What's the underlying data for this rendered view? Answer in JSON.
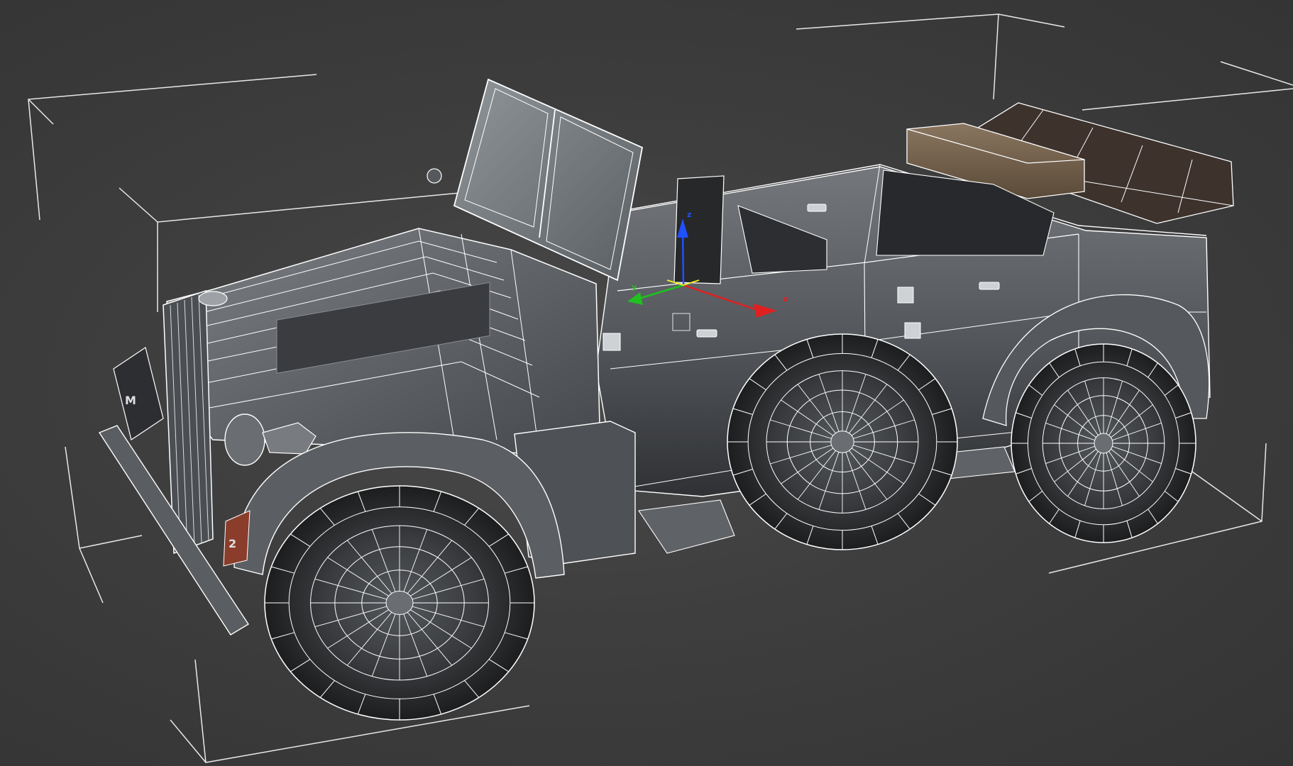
{
  "viewport": {
    "background_color": "#3e3e3e",
    "wire_color": "#ffffff",
    "selection_bracket_color": "#ffffff"
  },
  "model": {
    "type": "wireframe-on-shaded 3D vehicle model",
    "body_color": "#5c5f64",
    "cargo_crate_color": "#6b5a45",
    "folded_roof_color": "#3b302b",
    "plate_text": "M",
    "plate_number": "2",
    "marking_color": "#b0442e",
    "wheel_count": 3
  },
  "gizmo": {
    "x_label": "x",
    "y_label": "y",
    "z_label": "z",
    "x_color": "#e02020",
    "y_color": "#20c020",
    "z_color": "#2050ff",
    "center_color": "#f0f020"
  }
}
